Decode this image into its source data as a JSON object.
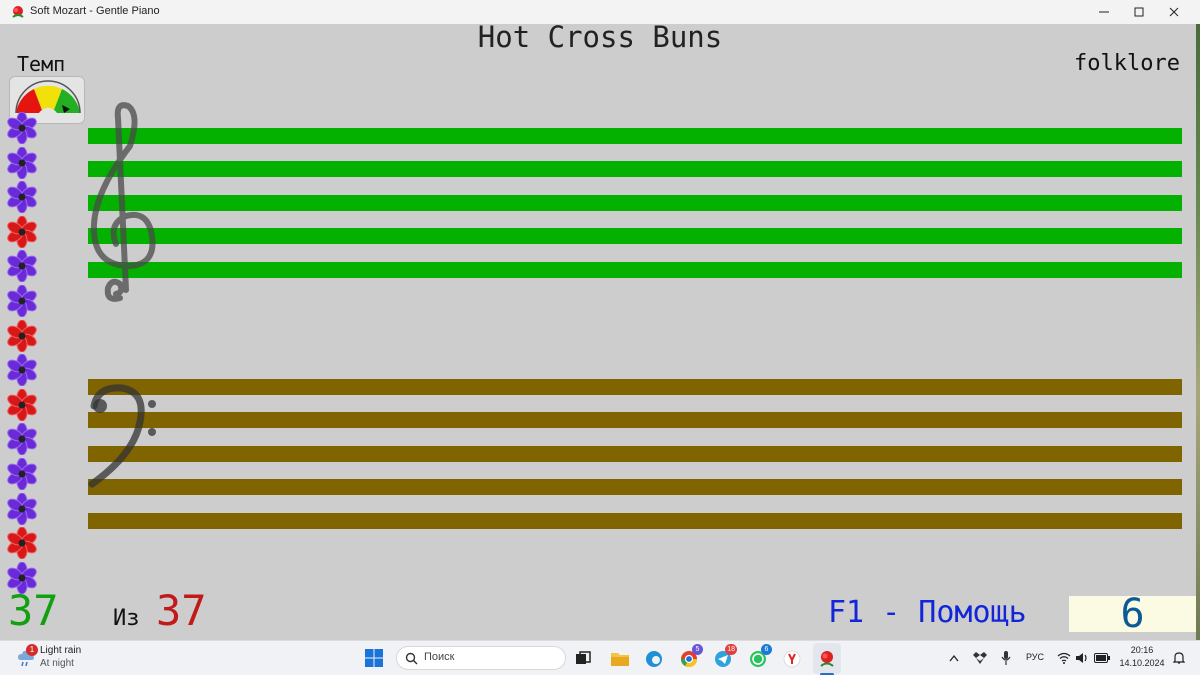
{
  "window": {
    "title": "Soft Mozart - Gentle Piano"
  },
  "song": {
    "title": "Hot Cross Buns",
    "author": "folklore"
  },
  "tempo": {
    "label": "Темп",
    "level": 0.85
  },
  "flowers": [
    "purple",
    "purple",
    "purple",
    "red",
    "purple",
    "purple",
    "red",
    "purple",
    "red",
    "purple",
    "purple",
    "purple",
    "red",
    "purple"
  ],
  "progress": {
    "done": "37",
    "of_label": "Из",
    "total": "37"
  },
  "help": {
    "label": "F1 - Помощь"
  },
  "score": {
    "value": "6"
  },
  "colors": {
    "treble_staff": "#04b000",
    "bass_staff": "#7f6400",
    "help_text": "#1226d8",
    "done_count": "#12a012",
    "total_count": "#c11a1a"
  },
  "taskbar": {
    "weather": {
      "badge": "1",
      "main": "Light rain",
      "sub": "At night"
    },
    "search_placeholder": "Поиск",
    "apps": [
      {
        "name": "task-view-icon"
      },
      {
        "name": "file-explorer-icon"
      },
      {
        "name": "edge-icon"
      },
      {
        "name": "chrome-icon",
        "badge": "5"
      },
      {
        "name": "telegram-icon",
        "badge": "18"
      },
      {
        "name": "whatsapp-icon",
        "badge": "6"
      },
      {
        "name": "yandex-browser-icon"
      },
      {
        "name": "soft-mozart-icon"
      }
    ],
    "language": "РУС",
    "time": "20:16",
    "date": "14.10.2024"
  }
}
